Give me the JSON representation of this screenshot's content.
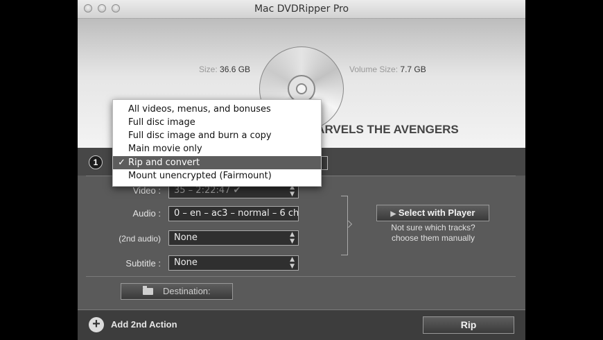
{
  "window": {
    "title": "Mac DVDRipper Pro"
  },
  "disc": {
    "size_label": "Size:",
    "size_value": "36.6 GB",
    "volume_label": "Volume Size:",
    "volume_value": "7.7 GB",
    "title": "MARVELS THE AVENGERS",
    "icon": "dvd-disc-icon"
  },
  "step": {
    "number": "1"
  },
  "action_menu": {
    "items": [
      {
        "label": "All videos, menus, and bonuses",
        "checked": false
      },
      {
        "label": "Full disc image",
        "checked": false
      },
      {
        "label": "Full disc image and burn a copy",
        "checked": false
      },
      {
        "label": "Main movie only",
        "checked": false
      },
      {
        "label": "Rip and convert",
        "checked": true
      },
      {
        "label": "Mount unencrypted (Fairmount)",
        "checked": false
      }
    ],
    "check_glyph": "✓"
  },
  "tracks": {
    "video_label": "Video :",
    "video_value": "35 – 2:22:47 ✔",
    "audio_label": "Audio :",
    "audio_value": "0 – en – ac3 – normal – 6 ch",
    "audio2_label": "(2nd audio)",
    "audio2_value": "None",
    "subtitle_label": "Subtitle :",
    "subtitle_value": "None",
    "stepper_glyph": "▲▼"
  },
  "player": {
    "button_label": "Select with Player",
    "hint_line1": "Not sure which tracks?",
    "hint_line2": "choose them manually"
  },
  "destination": {
    "label": "Destination:"
  },
  "footer": {
    "add_label": "Add 2nd Action",
    "rip_label": "Rip",
    "plus_glyph": "+"
  },
  "colors": {
    "panel": "#5a5a5a",
    "menu_highlight": "#5d5d5d"
  }
}
